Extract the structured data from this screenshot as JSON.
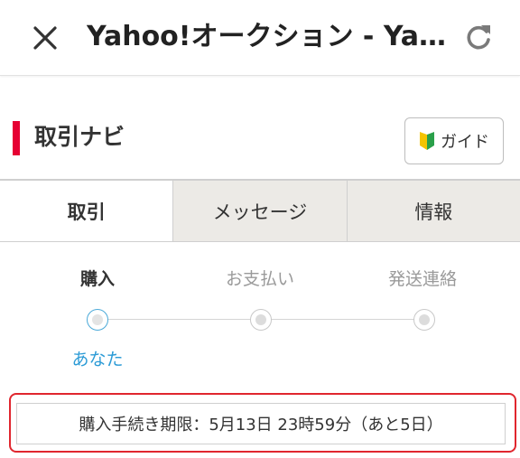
{
  "appbar": {
    "title": "Yahoo!オークション - Yahoo!オークション",
    "close_icon": "close-icon",
    "reload_icon": "reload-icon"
  },
  "section": {
    "title": "取引ナビ",
    "accent_color": "#e60033",
    "guide_label": "ガイド",
    "guide_icon": "beginner-mark-icon"
  },
  "tabs": [
    {
      "label": "取引",
      "active": true
    },
    {
      "label": "メッセージ",
      "active": false
    },
    {
      "label": "情報",
      "active": false
    }
  ],
  "steps": {
    "items": [
      {
        "label": "購入",
        "current": true
      },
      {
        "label": "お支払い",
        "current": false
      },
      {
        "label": "発送連絡",
        "current": false
      }
    ],
    "current_actor": "あなた",
    "actor_color": "#2c9bd6"
  },
  "deadline": {
    "text": "購入手続き期限：5月13日 23時59分（あと5日）",
    "highlight_color": "#e0262e"
  }
}
